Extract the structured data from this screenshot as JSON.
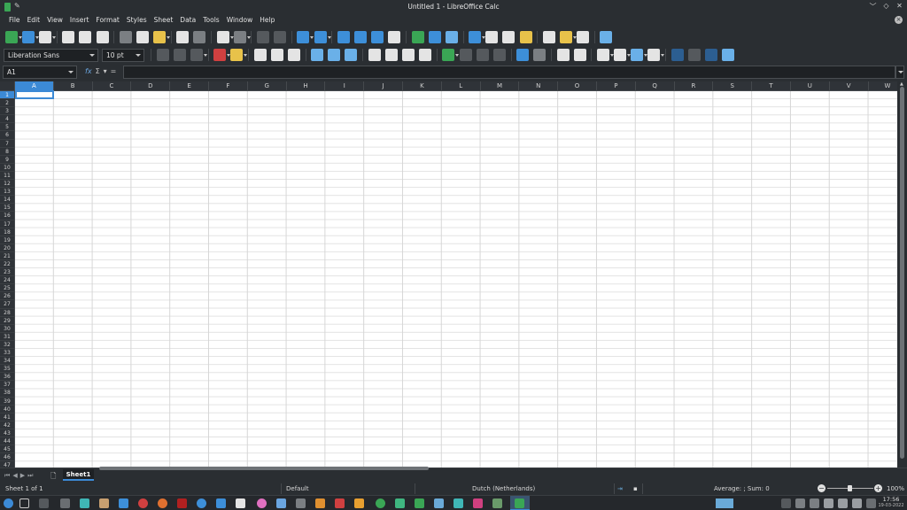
{
  "window": {
    "title": "Untitled 1 - LibreOffice Calc",
    "controls": [
      "﹀",
      "◇",
      "✕"
    ]
  },
  "menu": [
    "File",
    "Edit",
    "View",
    "Insert",
    "Format",
    "Styles",
    "Sheet",
    "Data",
    "Tools",
    "Window",
    "Help"
  ],
  "toolbar_formatting": {
    "font_name": "Liberation Sans",
    "font_size": "10 pt"
  },
  "formula_bar": {
    "name_box": "A1",
    "fx": "fx",
    "sum": "Σ",
    "equals": "=",
    "formula": ""
  },
  "grid": {
    "columns": [
      "A",
      "B",
      "C",
      "D",
      "E",
      "F",
      "G",
      "H",
      "I",
      "J",
      "K",
      "L",
      "M",
      "N",
      "O",
      "P",
      "Q",
      "R",
      "S",
      "T",
      "U",
      "V",
      "W"
    ],
    "rows": [
      "1",
      "2",
      "3",
      "4",
      "5",
      "6",
      "7",
      "8",
      "9",
      "10",
      "11",
      "12",
      "13",
      "14",
      "15",
      "16",
      "17",
      "18",
      "19",
      "20",
      "21",
      "22",
      "23",
      "24",
      "25",
      "26",
      "27",
      "28",
      "29",
      "30",
      "31",
      "32",
      "33",
      "34",
      "35",
      "36",
      "37",
      "38",
      "39",
      "40",
      "41",
      "42",
      "43",
      "44",
      "45",
      "46",
      "47"
    ],
    "active_cell": "A1"
  },
  "sheets": {
    "tabs": [
      "Sheet1"
    ],
    "active": "Sheet1"
  },
  "statusbar": {
    "sheet_position": "Sheet 1 of 1",
    "page_style": "Default",
    "language": "Dutch (Netherlands)",
    "selection_summary": "Average: ; Sum: 0",
    "zoom": "100%"
  },
  "taskbar": {
    "time": "17:56",
    "date": "19-03-2022"
  },
  "colors": {
    "accent": "#3c8ad6",
    "chrome_bg": "#2a2e32",
    "grid_bg": "#ffffff"
  }
}
